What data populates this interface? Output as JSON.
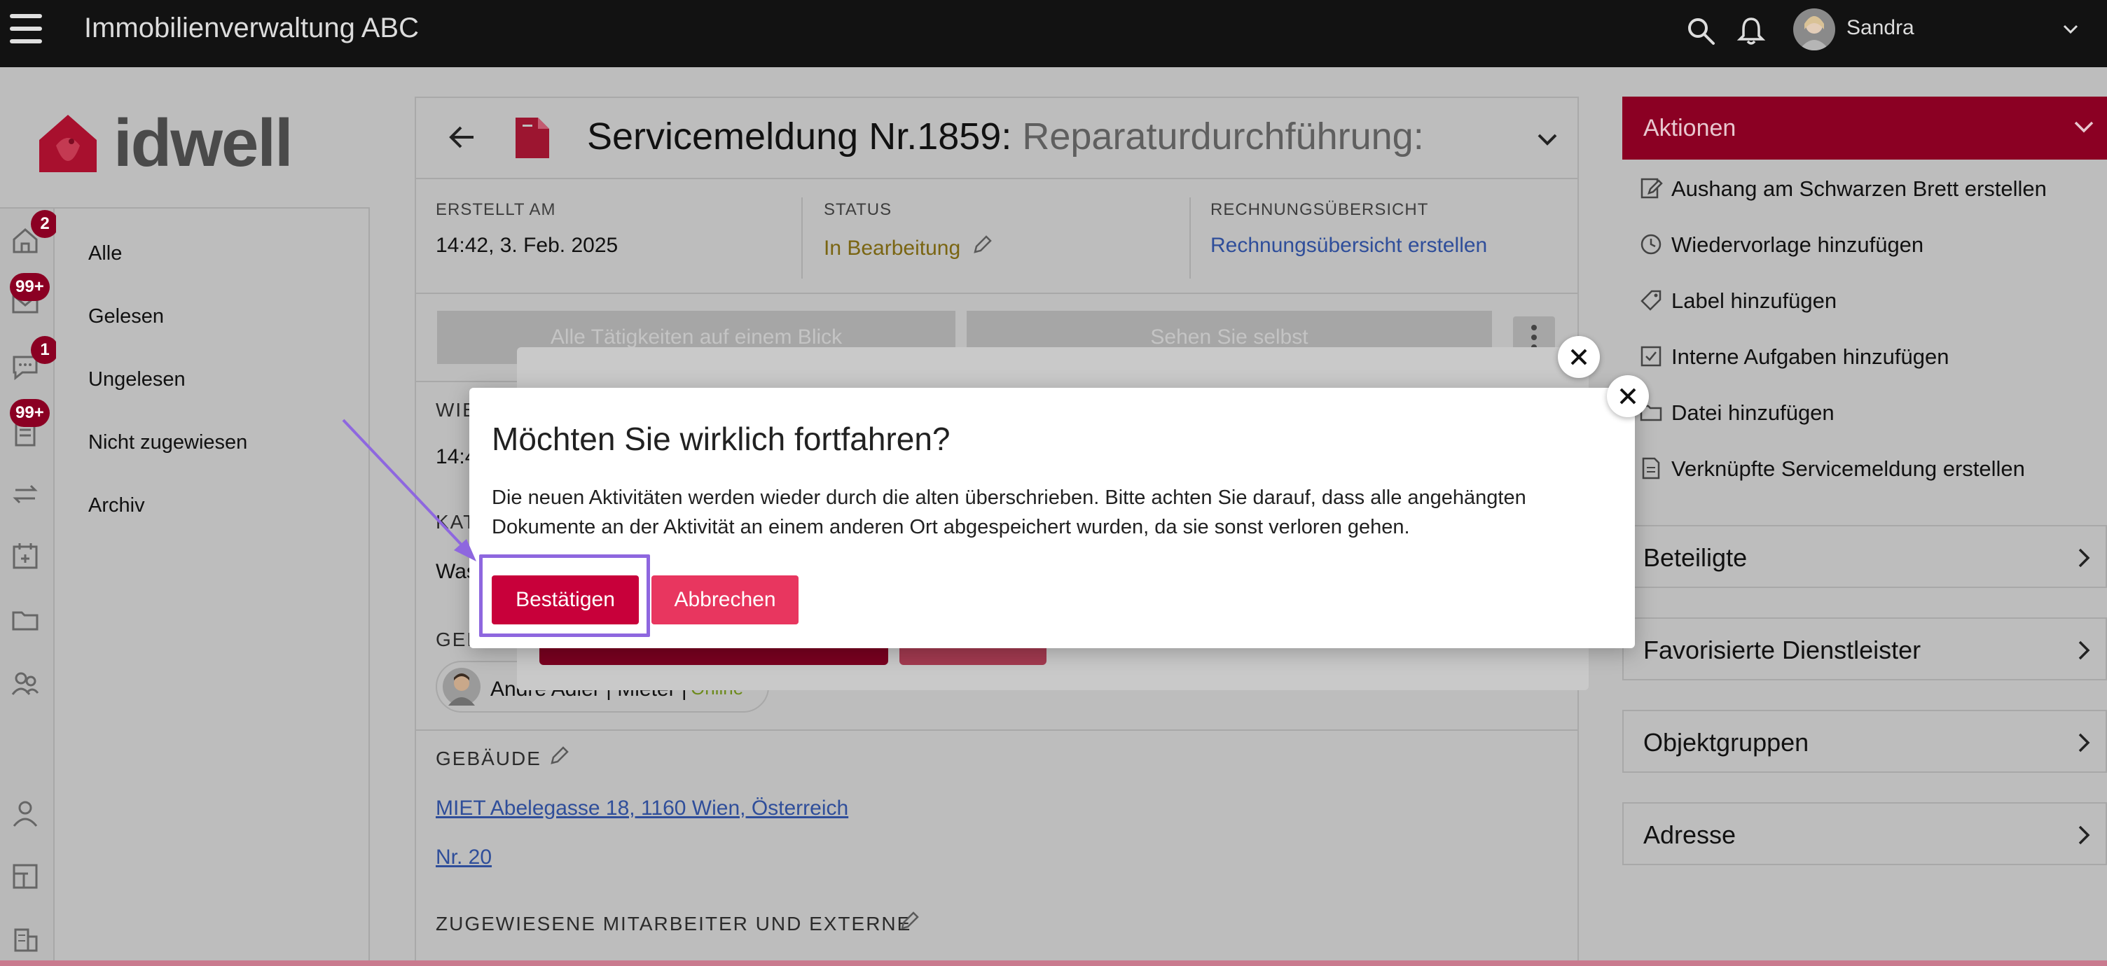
{
  "app": {
    "title": "Immobilienverwaltung ABC",
    "user_name": "Sandra"
  },
  "brand": {
    "logo_text": "idwell",
    "accent": "#c8003a",
    "dark_accent": "#8b0023"
  },
  "rail": {
    "badges": {
      "home": "2",
      "mail": "99+",
      "chat": "1",
      "tasks": "99+"
    }
  },
  "filters": [
    "Alle",
    "Gelesen",
    "Ungelesen",
    "Nicht zugewiesen",
    "Archiv"
  ],
  "ticket": {
    "title": "Servicemeldung Nr.1859:",
    "subtitle": "Reparaturdurchführung:",
    "created_label": "ERSTELLT AM",
    "created_value": "14:42, 3. Feb. 2025",
    "status_label": "STATUS",
    "status_value": "In Bearbeitung",
    "invoice_label": "RECHNUNGSÜBERSICHT",
    "invoice_link": "Rechnungsübersicht erstellen",
    "step1": "Alle Tätigkeiten auf einem Blick",
    "step2": "Sehen Sie selbst",
    "partial_label_1": "WIE",
    "partial_value_1": "14:4",
    "partial_label_2": "KAT",
    "partial_value_2": "Was",
    "partial_label_3": "GEN",
    "contact_text": "André Adler | Mieter |",
    "contact_status": "Online",
    "building_label": "GEBÄUDE",
    "building_link": "MIET Abelegasse 18, 1160 Wien, Österreich",
    "unit_link": "Nr. 20",
    "assigned_label": "ZUGEWIESENE MITARBEITER UND EXTERNE"
  },
  "actions": {
    "title": "Aktionen",
    "items": [
      "Aushang am Schwarzen Brett erstellen",
      "Wiedervorlage hinzufügen",
      "Label hinzufügen",
      "Interne Aufgaben hinzufügen",
      "Datei hinzufügen",
      "Verknüpfte Servicemeldung erstellen"
    ]
  },
  "panels": [
    "Beteiligte",
    "Favorisierte Dienstleister",
    "Objektgruppen",
    "Adresse"
  ],
  "dialog": {
    "title": "Möchten Sie wirklich fortfahren?",
    "text_line1": "Die neuen Aktivitäten werden wieder durch die alten überschrieben. Bitte achten Sie darauf, dass alle angehängten",
    "text_line2": "Dokumente an der Aktivität an einem anderen Ort abgespeichert wurden, da sie sonst verloren gehen.",
    "confirm": "Bestätigen",
    "cancel": "Abbrechen"
  }
}
